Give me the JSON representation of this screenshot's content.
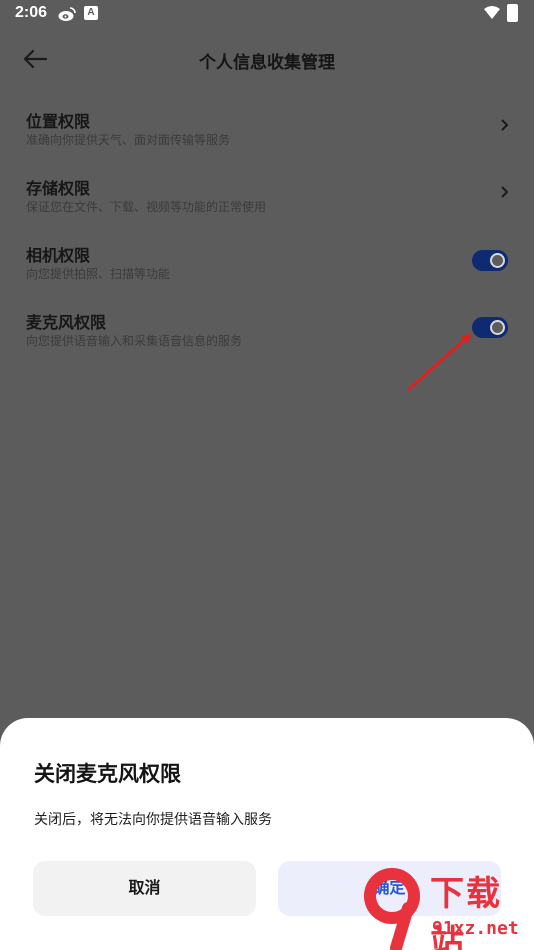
{
  "status_bar": {
    "time": "2:06",
    "extra_icon": "A"
  },
  "header": {
    "title": "个人信息收集管理"
  },
  "permissions": [
    {
      "title": "位置权限",
      "subtitle": "准确向你提供天气、面对面传输等服务",
      "control": "chevron"
    },
    {
      "title": "存储权限",
      "subtitle": "保证您在文件、下载、视频等功能的正常使用",
      "control": "chevron"
    },
    {
      "title": "相机权限",
      "subtitle": "向您提供拍照、扫描等功能",
      "control": "toggle",
      "enabled": true
    },
    {
      "title": "麦克风权限",
      "subtitle": "向您提供语音输入和采集语音信息的服务",
      "control": "toggle",
      "enabled": true
    }
  ],
  "dialog": {
    "title": "关闭麦克风权限",
    "message": "关闭后，将无法向你提供语音输入服务",
    "cancel_label": "取消",
    "confirm_label": "确定"
  },
  "watermark": {
    "text": "下载站",
    "url": "91xz.net",
    "logo_glyph": "9"
  },
  "colors": {
    "overlay": "#5c5c5c",
    "toggle_on": "#0d2a73",
    "confirm_text": "#2a56d6",
    "arrow": "#e02020",
    "watermark": "#e8323d"
  },
  "icons": [
    "weibo-icon",
    "wifi-icon",
    "battery-icon",
    "back-arrow-icon",
    "chevron-right-icon"
  ]
}
